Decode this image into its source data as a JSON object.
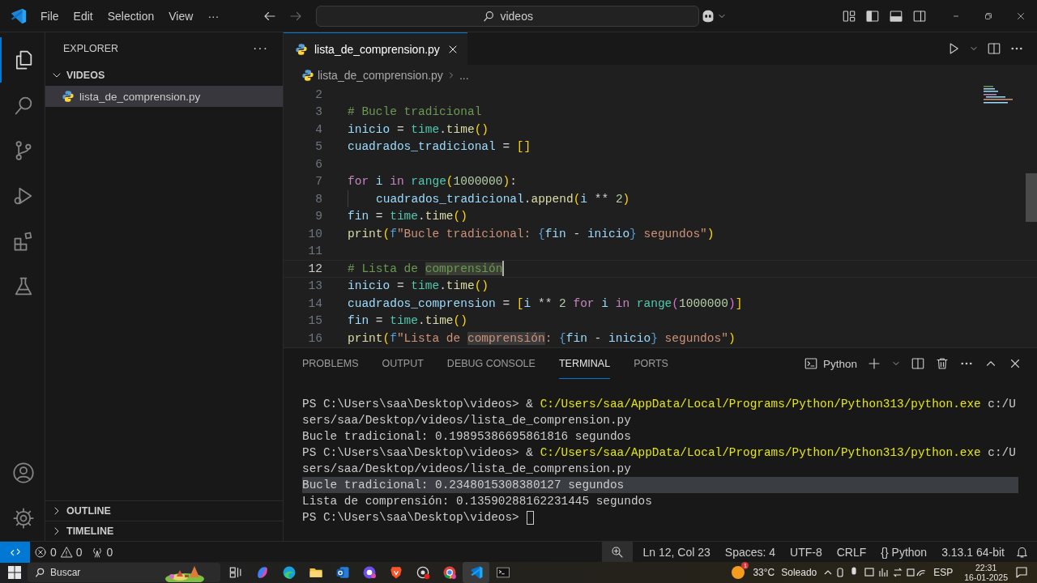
{
  "title_bar": {
    "menu": [
      "File",
      "Edit",
      "Selection",
      "View",
      "···"
    ],
    "search": {
      "value": "videos"
    }
  },
  "activity_bar": [
    {
      "kind": "files",
      "selected": true
    },
    {
      "kind": "search",
      "selected": false
    },
    {
      "kind": "source-control",
      "selected": false
    },
    {
      "kind": "run",
      "selected": false
    },
    {
      "kind": "extensions",
      "selected": false
    },
    {
      "kind": "testing",
      "selected": false
    },
    {
      "kind": "account",
      "selected": false
    },
    {
      "kind": "settings",
      "selected": false
    }
  ],
  "sidebar": {
    "title": "EXPLORER",
    "more": "···",
    "folder": {
      "name": "VIDEOS",
      "expanded": true,
      "children": [
        {
          "name": "lista_de_comprension.py",
          "selected": true
        }
      ]
    },
    "sections": [
      {
        "label": "OUTLINE",
        "expanded": false
      },
      {
        "label": "TIMELINE",
        "expanded": false
      }
    ]
  },
  "editor": {
    "tabs": [
      {
        "label": "lista_de_comprension.py",
        "selected": true
      }
    ],
    "breadcrumb": [
      "lista_de_comprension.py",
      "..."
    ],
    "lines": [
      {
        "number": "2",
        "current": false
      },
      {
        "number": "3",
        "current": false,
        "tokens": [
          {
            "kind": "comment",
            "text": "# Bucle tradicional"
          }
        ]
      },
      {
        "number": "4",
        "current": false,
        "tokens": [
          {
            "kind": "var",
            "text": "inicio"
          },
          {
            "kind": "op",
            "text": " = "
          },
          {
            "kind": "module",
            "text": "time"
          },
          {
            "kind": "op",
            "text": "."
          },
          {
            "kind": "func",
            "text": "time"
          },
          {
            "kind": "bracket",
            "text": "()"
          }
        ]
      },
      {
        "number": "5",
        "current": false,
        "tokens": [
          {
            "kind": "var",
            "text": "cuadrados_tradicional"
          },
          {
            "kind": "op",
            "text": " = "
          },
          {
            "kind": "bracket",
            "text": "[]"
          }
        ]
      },
      {
        "number": "6",
        "current": false
      },
      {
        "number": "7",
        "current": false,
        "tokens": [
          {
            "kind": "keyword",
            "text": "for"
          },
          {
            "kind": "var",
            "text": " i"
          },
          {
            "kind": "keyword",
            "text": " in"
          },
          {
            "kind": "module",
            "text": " range"
          },
          {
            "kind": "bracket",
            "text": "("
          },
          {
            "kind": "num",
            "text": "1000000"
          },
          {
            "kind": "bracket",
            "text": ")"
          },
          {
            "kind": "op",
            "text": ":"
          }
        ]
      },
      {
        "number": "8",
        "current": false,
        "indented": true,
        "tokens": [
          {
            "kind": "var",
            "text": "cuadrados_tradicional"
          },
          {
            "kind": "op",
            "text": "."
          },
          {
            "kind": "func",
            "text": "append"
          },
          {
            "kind": "bracket",
            "text": "("
          },
          {
            "kind": "var",
            "text": "i"
          },
          {
            "kind": "op",
            "text": " ** "
          },
          {
            "kind": "num",
            "text": "2"
          },
          {
            "kind": "bracket",
            "text": ")"
          }
        ]
      },
      {
        "number": "9",
        "current": false,
        "tokens": [
          {
            "kind": "var",
            "text": "fin"
          },
          {
            "kind": "op",
            "text": " = "
          },
          {
            "kind": "module",
            "text": "time"
          },
          {
            "kind": "op",
            "text": "."
          },
          {
            "kind": "func",
            "text": "time"
          },
          {
            "kind": "bracket",
            "text": "()"
          }
        ]
      },
      {
        "number": "10",
        "current": false,
        "tokens": [
          {
            "kind": "func",
            "text": "print"
          },
          {
            "kind": "bracket",
            "text": "("
          },
          {
            "kind": "fprefix",
            "text": "f"
          },
          {
            "kind": "str",
            "text": "\"Bucle tradicional: "
          },
          {
            "kind": "fprefix",
            "text": "{"
          },
          {
            "kind": "var",
            "text": "fin"
          },
          {
            "kind": "op",
            "text": " - "
          },
          {
            "kind": "var",
            "text": "inicio"
          },
          {
            "kind": "fprefix",
            "text": "}"
          },
          {
            "kind": "str",
            "text": " segundos\""
          },
          {
            "kind": "bracket",
            "text": ")"
          }
        ]
      },
      {
        "number": "11",
        "current": false
      },
      {
        "number": "12",
        "current": true,
        "tokens": [
          {
            "kind": "comment",
            "text": "# Lista de "
          },
          {
            "kind": "comment-match",
            "text": "comprensión"
          }
        ]
      },
      {
        "number": "13",
        "current": false,
        "tokens": [
          {
            "kind": "var",
            "text": "inicio"
          },
          {
            "kind": "op",
            "text": " = "
          },
          {
            "kind": "module",
            "text": "time"
          },
          {
            "kind": "op",
            "text": "."
          },
          {
            "kind": "func",
            "text": "time"
          },
          {
            "kind": "bracket",
            "text": "()"
          }
        ]
      },
      {
        "number": "14",
        "current": false,
        "tokens": [
          {
            "kind": "var",
            "text": "cuadrados_comprension"
          },
          {
            "kind": "op",
            "text": " = "
          },
          {
            "kind": "bracket",
            "text": "["
          },
          {
            "kind": "var",
            "text": "i"
          },
          {
            "kind": "op",
            "text": " ** "
          },
          {
            "kind": "num",
            "text": "2"
          },
          {
            "kind": "keyword",
            "text": " for"
          },
          {
            "kind": "var",
            "text": " i"
          },
          {
            "kind": "keyword",
            "text": " in"
          },
          {
            "kind": "module",
            "text": " range"
          },
          {
            "kind": "bracket2",
            "text": "("
          },
          {
            "kind": "num",
            "text": "1000000"
          },
          {
            "kind": "bracket2",
            "text": ")"
          },
          {
            "kind": "bracket",
            "text": "]"
          }
        ]
      },
      {
        "number": "15",
        "current": false,
        "tokens": [
          {
            "kind": "var",
            "text": "fin"
          },
          {
            "kind": "op",
            "text": " = "
          },
          {
            "kind": "module",
            "text": "time"
          },
          {
            "kind": "op",
            "text": "."
          },
          {
            "kind": "func",
            "text": "time"
          },
          {
            "kind": "bracket",
            "text": "()"
          }
        ]
      },
      {
        "number": "16",
        "current": false,
        "tokens": [
          {
            "kind": "func",
            "text": "print"
          },
          {
            "kind": "bracket",
            "text": "("
          },
          {
            "kind": "fprefix",
            "text": "f"
          },
          {
            "kind": "str",
            "text": "\"Lista de "
          },
          {
            "kind": "str-match",
            "text": "comprensión"
          },
          {
            "kind": "str",
            "text": ": "
          },
          {
            "kind": "fprefix",
            "text": "{"
          },
          {
            "kind": "var",
            "text": "fin"
          },
          {
            "kind": "op",
            "text": " - "
          },
          {
            "kind": "var",
            "text": "inicio"
          },
          {
            "kind": "fprefix",
            "text": "}"
          },
          {
            "kind": "str",
            "text": " segundos\""
          },
          {
            "kind": "bracket",
            "text": ")"
          }
        ]
      }
    ]
  },
  "panel": {
    "tabs": [
      {
        "label": "PROBLEMS",
        "selected": false
      },
      {
        "label": "OUTPUT",
        "selected": false
      },
      {
        "label": "DEBUG CONSOLE",
        "selected": false
      },
      {
        "label": "TERMINAL",
        "selected": true
      },
      {
        "label": "PORTS",
        "selected": false
      }
    ],
    "terminal_profile": "Python",
    "terminal_lines": [
      {
        "kind": "command",
        "selected": false,
        "segments": [
          {
            "kind": "plain",
            "text": "PS C:\\Users\\saa\\Desktop\\videos> & "
          },
          {
            "kind": "path",
            "text": "C:/Users/saa/AppData/Local/Programs/Python/Python313/python.exe"
          },
          {
            "kind": "plain",
            "text": " c:/U"
          }
        ]
      },
      {
        "kind": "output",
        "selected": false,
        "segments": [
          {
            "kind": "plain",
            "text": "sers/saa/Desktop/videos/lista_de_comprension.py"
          }
        ]
      },
      {
        "kind": "output",
        "selected": false,
        "segments": [
          {
            "kind": "plain",
            "text": "Bucle tradicional: 0.19895386695861816 segundos"
          }
        ]
      },
      {
        "kind": "command",
        "selected": false,
        "segments": [
          {
            "kind": "plain",
            "text": "PS C:\\Users\\saa\\Desktop\\videos> & "
          },
          {
            "kind": "path",
            "text": "C:/Users/saa/AppData/Local/Programs/Python/Python313/python.exe"
          },
          {
            "kind": "plain",
            "text": " c:/U"
          }
        ]
      },
      {
        "kind": "output",
        "selected": false,
        "segments": [
          {
            "kind": "plain",
            "text": "sers/saa/Desktop/videos/lista_de_comprension.py"
          }
        ]
      },
      {
        "kind": "output",
        "selected": true,
        "segments": [
          {
            "kind": "plain",
            "text": "Bucle tradicional: 0.2348015308380127 segundos"
          }
        ]
      },
      {
        "kind": "output",
        "selected": false,
        "segments": [
          {
            "kind": "plain",
            "text": "Lista de comprensión: 0.13590288162231445 segundos"
          }
        ]
      },
      {
        "kind": "input",
        "selected": false,
        "segments": [
          {
            "kind": "plain",
            "text": "PS C:\\Users\\saa\\Desktop\\videos> "
          }
        ]
      }
    ]
  },
  "status_bar": {
    "errors": "0",
    "warnings": "0",
    "ports": "0",
    "items": [
      {
        "kind": "text",
        "text": "Ln 12, Col 23"
      },
      {
        "kind": "text",
        "text": "Spaces: 4"
      },
      {
        "kind": "text",
        "text": "UTF-8"
      },
      {
        "kind": "text",
        "text": "CRLF"
      },
      {
        "kind": "language",
        "icon": "{}",
        "text": "Python"
      },
      {
        "kind": "text",
        "text": "3.13.1 64-bit"
      }
    ]
  },
  "taskbar": {
    "search_placeholder": "Buscar",
    "apps": [
      {
        "kind": "task-view",
        "selected": false
      },
      {
        "kind": "copilot",
        "selected": false
      },
      {
        "kind": "edge",
        "selected": false
      },
      {
        "kind": "folder",
        "selected": false
      },
      {
        "kind": "mail",
        "selected": false
      },
      {
        "kind": "chat",
        "selected": false
      },
      {
        "kind": "brave",
        "selected": false
      },
      {
        "kind": "recorder",
        "selected": false
      },
      {
        "kind": "chrome",
        "selected": false
      },
      {
        "kind": "code",
        "selected": true
      },
      {
        "kind": "terminal",
        "selected": false
      }
    ],
    "weather": {
      "badge": "1",
      "temperature": "33°C",
      "condition": "Soleado"
    },
    "language": "ESP",
    "time": "22:31",
    "date": "16-01-2025"
  }
}
